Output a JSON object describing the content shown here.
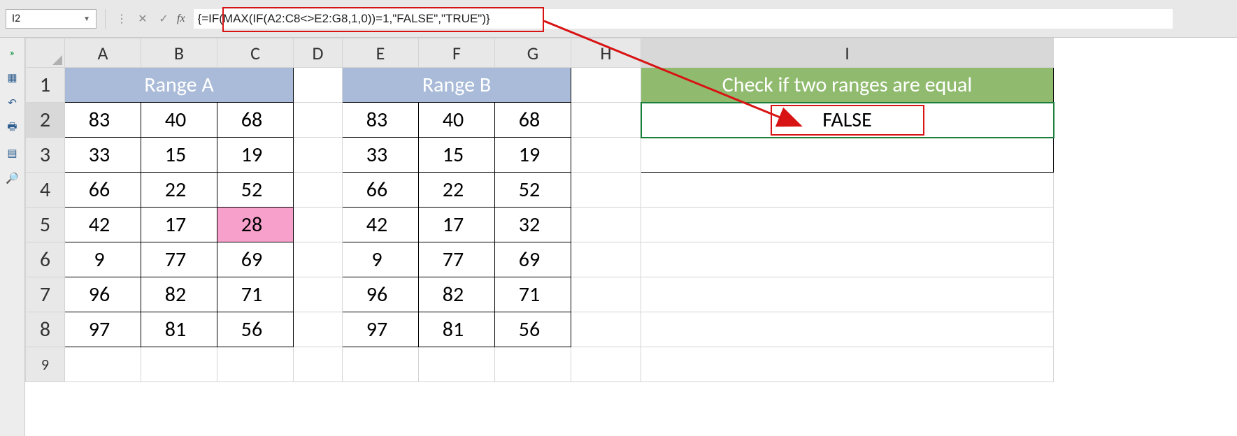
{
  "name_box": "I2",
  "formula": "{=IF(MAX(IF(A2:C8<>E2:G8,1,0))=1,\"FALSE\",\"TRUE\")}",
  "columns": [
    "A",
    "B",
    "C",
    "D",
    "E",
    "F",
    "G",
    "H",
    "I"
  ],
  "row_numbers": [
    "1",
    "2",
    "3",
    "4",
    "5",
    "6",
    "7",
    "8",
    "9"
  ],
  "headers": {
    "rangeA": "Range A",
    "rangeB": "Range B",
    "check": "Check if two ranges are equal"
  },
  "rangeA": [
    [
      83,
      40,
      68
    ],
    [
      33,
      15,
      19
    ],
    [
      66,
      22,
      52
    ],
    [
      42,
      17,
      28
    ],
    [
      9,
      77,
      69
    ],
    [
      96,
      82,
      71
    ],
    [
      97,
      81,
      56
    ]
  ],
  "rangeB": [
    [
      83,
      40,
      68
    ],
    [
      33,
      15,
      19
    ],
    [
      66,
      22,
      52
    ],
    [
      42,
      17,
      32
    ],
    [
      9,
      77,
      69
    ],
    [
      96,
      82,
      71
    ],
    [
      97,
      81,
      56
    ]
  ],
  "result": "FALSE",
  "highlight_cell": "C5",
  "sidebar_icons": [
    "expand",
    "table",
    "undo",
    "print",
    "grid",
    "binoculars"
  ]
}
